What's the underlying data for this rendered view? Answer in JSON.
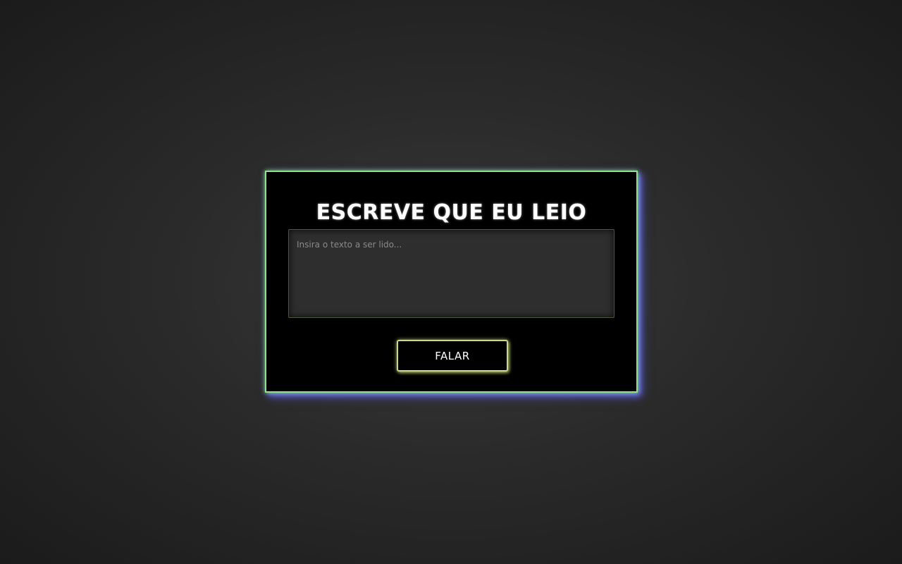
{
  "app": {
    "title": "ESCREVE QUE EU LEIO"
  },
  "form": {
    "text_input": {
      "value": "",
      "placeholder": "Insira o texto a ser lido..."
    },
    "speak_button_label": "FALAR"
  },
  "colors": {
    "background": "#2a2a2a",
    "card": "#000000",
    "card_border": "#8fe08f",
    "card_glow": "#6e6eff",
    "input_background": "#2e2e2e",
    "button_border": "#c9d98c",
    "text": "#ffffff"
  }
}
